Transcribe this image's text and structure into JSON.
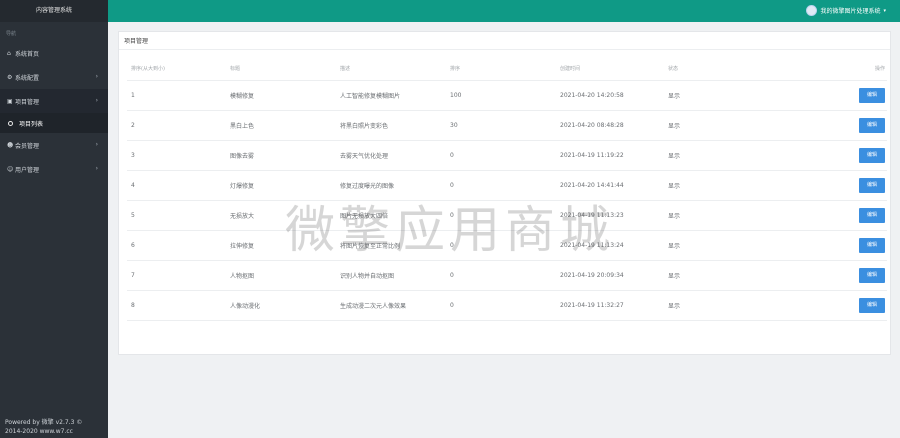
{
  "app_title": "内容管理系统",
  "sidebar": {
    "section": "导航",
    "items": [
      {
        "label": "系统首页",
        "icon": "home-icon"
      },
      {
        "label": "系统配置",
        "icon": "gear-icon",
        "chevron": "›"
      },
      {
        "label": "项目管理",
        "icon": "box-icon",
        "chevron": "›"
      },
      {
        "label": "会员管理",
        "icon": "users-icon",
        "chevron": "›"
      },
      {
        "label": "用户管理",
        "icon": "user-icon",
        "chevron": "›"
      }
    ],
    "active_subitem": "项目列表",
    "footer_line1": "Powered by 微擎 v2.7.3 ©",
    "footer_line2": "2014-2020 www.w7.cc"
  },
  "topbar": {
    "user_name": "我的微擎图片处理系统",
    "caret": "▾",
    "color": "#0f9a86"
  },
  "card": {
    "title": "项目管理",
    "columns": [
      "排序(从大到小)",
      "标题",
      "描述",
      "排序",
      "创建时间",
      "状态",
      "操作"
    ],
    "rows": [
      {
        "c1": "1",
        "c2": "模糊修复",
        "c3": "人工智能修复模糊图片",
        "c4": "100",
        "c5": "2021-04-20 14:20:58",
        "c6": "显示",
        "action": "编辑"
      },
      {
        "c1": "2",
        "c2": "黑白上色",
        "c3": "将黑白照片变彩色",
        "c4": "30",
        "c5": "2021-04-20 08:48:28",
        "c6": "显示",
        "action": "编辑"
      },
      {
        "c1": "3",
        "c2": "图像去雾",
        "c3": "去雾天气优化处理",
        "c4": "0",
        "c5": "2021-04-19 11:19:22",
        "c6": "显示",
        "action": "编辑"
      },
      {
        "c1": "4",
        "c2": "灯爆修复",
        "c3": "修复过度曝光的图像",
        "c4": "0",
        "c5": "2021-04-20 14:41:44",
        "c6": "显示",
        "action": "编辑"
      },
      {
        "c1": "5",
        "c2": "无损放大",
        "c3": "图片无损放大四倍",
        "c4": "0",
        "c5": "2021-04-19 11:13:23",
        "c6": "显示",
        "action": "编辑"
      },
      {
        "c1": "6",
        "c2": "拉伸修复",
        "c3": "将图片恢复至正常比例",
        "c4": "0",
        "c5": "2021-04-19 11:13:24",
        "c6": "显示",
        "action": "编辑"
      },
      {
        "c1": "7",
        "c2": "人物抠图",
        "c3": "识别人物并自动抠图",
        "c4": "0",
        "c5": "2021-04-19 20:09:34",
        "c6": "显示",
        "action": "编辑"
      },
      {
        "c1": "8",
        "c2": "人像动漫化",
        "c3": "生成动漫二次元人像效果",
        "c4": "0",
        "c5": "2021-04-19 11:32:27",
        "c6": "显示",
        "action": "编辑"
      }
    ]
  },
  "watermark": "微擎应用商城",
  "accent": "#3b8fe0"
}
